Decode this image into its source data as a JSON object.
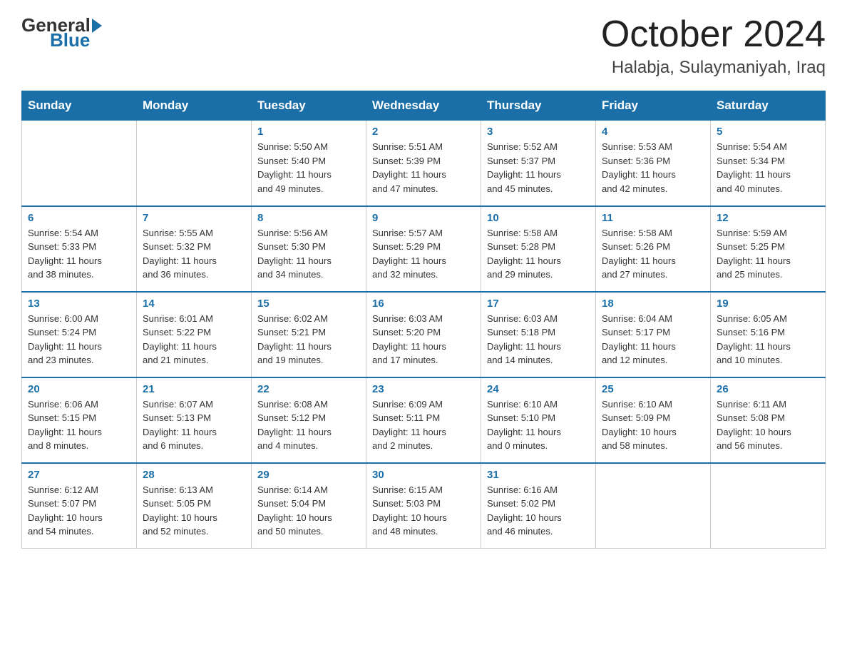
{
  "header": {
    "logo_general": "General",
    "logo_blue": "Blue",
    "month": "October 2024",
    "location": "Halabja, Sulaymaniyah, Iraq"
  },
  "weekdays": [
    "Sunday",
    "Monday",
    "Tuesday",
    "Wednesday",
    "Thursday",
    "Friday",
    "Saturday"
  ],
  "weeks": [
    [
      {
        "day": "",
        "info": ""
      },
      {
        "day": "",
        "info": ""
      },
      {
        "day": "1",
        "info": "Sunrise: 5:50 AM\nSunset: 5:40 PM\nDaylight: 11 hours\nand 49 minutes."
      },
      {
        "day": "2",
        "info": "Sunrise: 5:51 AM\nSunset: 5:39 PM\nDaylight: 11 hours\nand 47 minutes."
      },
      {
        "day": "3",
        "info": "Sunrise: 5:52 AM\nSunset: 5:37 PM\nDaylight: 11 hours\nand 45 minutes."
      },
      {
        "day": "4",
        "info": "Sunrise: 5:53 AM\nSunset: 5:36 PM\nDaylight: 11 hours\nand 42 minutes."
      },
      {
        "day": "5",
        "info": "Sunrise: 5:54 AM\nSunset: 5:34 PM\nDaylight: 11 hours\nand 40 minutes."
      }
    ],
    [
      {
        "day": "6",
        "info": "Sunrise: 5:54 AM\nSunset: 5:33 PM\nDaylight: 11 hours\nand 38 minutes."
      },
      {
        "day": "7",
        "info": "Sunrise: 5:55 AM\nSunset: 5:32 PM\nDaylight: 11 hours\nand 36 minutes."
      },
      {
        "day": "8",
        "info": "Sunrise: 5:56 AM\nSunset: 5:30 PM\nDaylight: 11 hours\nand 34 minutes."
      },
      {
        "day": "9",
        "info": "Sunrise: 5:57 AM\nSunset: 5:29 PM\nDaylight: 11 hours\nand 32 minutes."
      },
      {
        "day": "10",
        "info": "Sunrise: 5:58 AM\nSunset: 5:28 PM\nDaylight: 11 hours\nand 29 minutes."
      },
      {
        "day": "11",
        "info": "Sunrise: 5:58 AM\nSunset: 5:26 PM\nDaylight: 11 hours\nand 27 minutes."
      },
      {
        "day": "12",
        "info": "Sunrise: 5:59 AM\nSunset: 5:25 PM\nDaylight: 11 hours\nand 25 minutes."
      }
    ],
    [
      {
        "day": "13",
        "info": "Sunrise: 6:00 AM\nSunset: 5:24 PM\nDaylight: 11 hours\nand 23 minutes."
      },
      {
        "day": "14",
        "info": "Sunrise: 6:01 AM\nSunset: 5:22 PM\nDaylight: 11 hours\nand 21 minutes."
      },
      {
        "day": "15",
        "info": "Sunrise: 6:02 AM\nSunset: 5:21 PM\nDaylight: 11 hours\nand 19 minutes."
      },
      {
        "day": "16",
        "info": "Sunrise: 6:03 AM\nSunset: 5:20 PM\nDaylight: 11 hours\nand 17 minutes."
      },
      {
        "day": "17",
        "info": "Sunrise: 6:03 AM\nSunset: 5:18 PM\nDaylight: 11 hours\nand 14 minutes."
      },
      {
        "day": "18",
        "info": "Sunrise: 6:04 AM\nSunset: 5:17 PM\nDaylight: 11 hours\nand 12 minutes."
      },
      {
        "day": "19",
        "info": "Sunrise: 6:05 AM\nSunset: 5:16 PM\nDaylight: 11 hours\nand 10 minutes."
      }
    ],
    [
      {
        "day": "20",
        "info": "Sunrise: 6:06 AM\nSunset: 5:15 PM\nDaylight: 11 hours\nand 8 minutes."
      },
      {
        "day": "21",
        "info": "Sunrise: 6:07 AM\nSunset: 5:13 PM\nDaylight: 11 hours\nand 6 minutes."
      },
      {
        "day": "22",
        "info": "Sunrise: 6:08 AM\nSunset: 5:12 PM\nDaylight: 11 hours\nand 4 minutes."
      },
      {
        "day": "23",
        "info": "Sunrise: 6:09 AM\nSunset: 5:11 PM\nDaylight: 11 hours\nand 2 minutes."
      },
      {
        "day": "24",
        "info": "Sunrise: 6:10 AM\nSunset: 5:10 PM\nDaylight: 11 hours\nand 0 minutes."
      },
      {
        "day": "25",
        "info": "Sunrise: 6:10 AM\nSunset: 5:09 PM\nDaylight: 10 hours\nand 58 minutes."
      },
      {
        "day": "26",
        "info": "Sunrise: 6:11 AM\nSunset: 5:08 PM\nDaylight: 10 hours\nand 56 minutes."
      }
    ],
    [
      {
        "day": "27",
        "info": "Sunrise: 6:12 AM\nSunset: 5:07 PM\nDaylight: 10 hours\nand 54 minutes."
      },
      {
        "day": "28",
        "info": "Sunrise: 6:13 AM\nSunset: 5:05 PM\nDaylight: 10 hours\nand 52 minutes."
      },
      {
        "day": "29",
        "info": "Sunrise: 6:14 AM\nSunset: 5:04 PM\nDaylight: 10 hours\nand 50 minutes."
      },
      {
        "day": "30",
        "info": "Sunrise: 6:15 AM\nSunset: 5:03 PM\nDaylight: 10 hours\nand 48 minutes."
      },
      {
        "day": "31",
        "info": "Sunrise: 6:16 AM\nSunset: 5:02 PM\nDaylight: 10 hours\nand 46 minutes."
      },
      {
        "day": "",
        "info": ""
      },
      {
        "day": "",
        "info": ""
      }
    ]
  ]
}
